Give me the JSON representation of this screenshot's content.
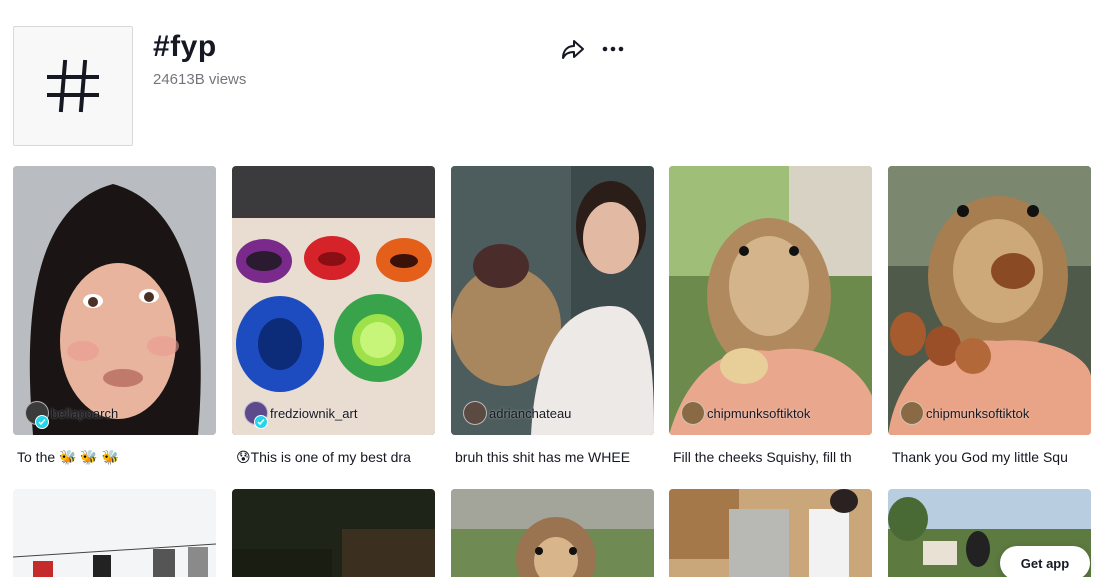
{
  "hashtag": {
    "title": "#fyp",
    "views": "24613B views"
  },
  "actions": {
    "share_icon": "share-arrow-icon",
    "more_icon": "more-dots-icon"
  },
  "videos": [
    {
      "author": "bellapoarch",
      "verified": true,
      "caption": "To the 🐝 🐝 🐝"
    },
    {
      "author": "fredziownik_art",
      "verified": true,
      "caption": "😰This is one of my best dra"
    },
    {
      "author": "adrianchateau",
      "verified": false,
      "caption": "bruh this shit has me WHEE"
    },
    {
      "author": "chipmunksoftiktok",
      "verified": false,
      "caption": "Fill the cheeks Squishy, fill th"
    },
    {
      "author": "chipmunksoftiktok",
      "verified": false,
      "caption": "Thank you God my little Squ"
    }
  ],
  "get_app_label": "Get app",
  "colors": {
    "verified": "#20d5ec",
    "text_primary": "#161823"
  }
}
